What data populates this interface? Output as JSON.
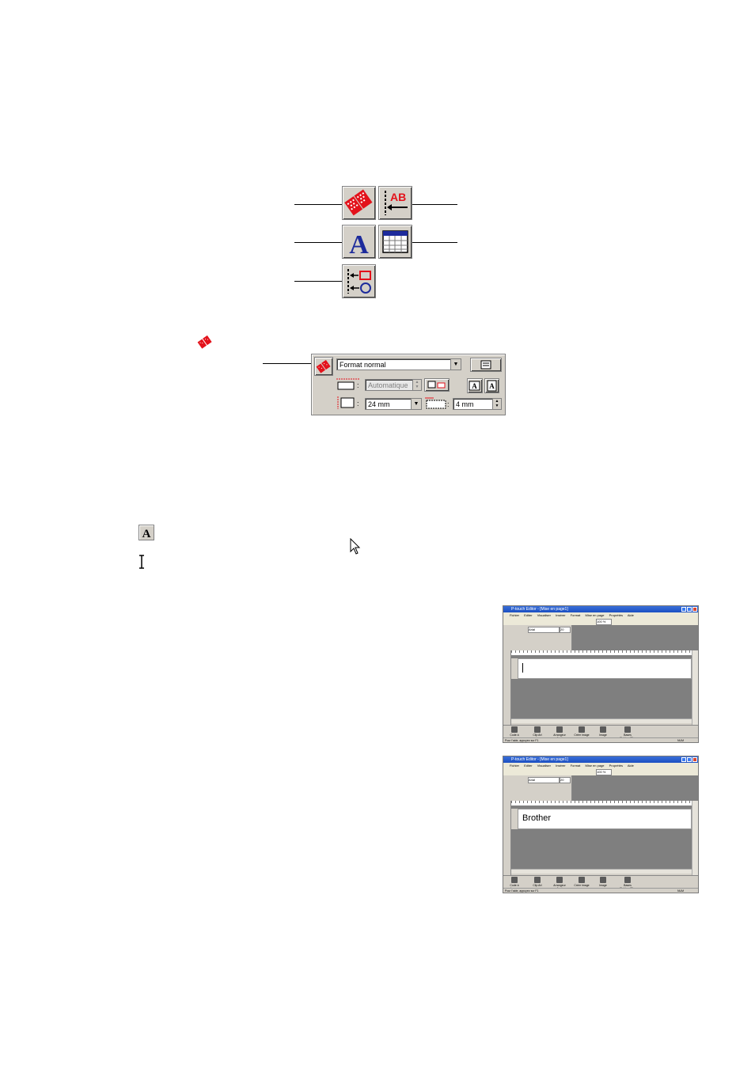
{
  "property_panel": {
    "format_select": "Format normal",
    "length_field": "Automatique",
    "tape_width": "24 mm",
    "margin_value": "4 mm"
  },
  "screenshots": [
    {
      "window_title": "P-touch Editor - [Mise en page1]",
      "menu": [
        "Fichier",
        "Editer",
        "Visualiser",
        "Insérer",
        "Format",
        "Mise en page",
        "Proprétés",
        "Aide"
      ],
      "font_name": "Arial",
      "font_size": "20",
      "zoom": "100 %",
      "label_text": "",
      "bottom_buttons": [
        "Code à barres",
        "Clip Art",
        "Arrangeur Ansi",
        "Créer image",
        "Image",
        "Bases Fichiers/Cl..."
      ],
      "status_left": "Pour l'aide, appuyez sur F1",
      "status_right": "NUM"
    },
    {
      "window_title": "P-touch Editor - [Mise en page1]",
      "menu": [
        "Fichier",
        "Editer",
        "Visualiser",
        "Insérer",
        "Format",
        "Mise en page",
        "Proprétés",
        "Aide"
      ],
      "font_name": "Arial",
      "font_size": "20",
      "zoom": "100 %",
      "label_text": "Brother",
      "bottom_buttons": [
        "Code à barres",
        "Clip Art",
        "Arrangeur Ansi",
        "Créer image",
        "Image",
        "Bases Fichiers/Cl..."
      ],
      "status_left": "Pour l'aide, appuyez sur F1",
      "status_right": "NUM"
    }
  ],
  "icons": {
    "tape-icon": "red striped tape",
    "text-icon": "A",
    "arrange-icon": "AB with arrow"
  }
}
